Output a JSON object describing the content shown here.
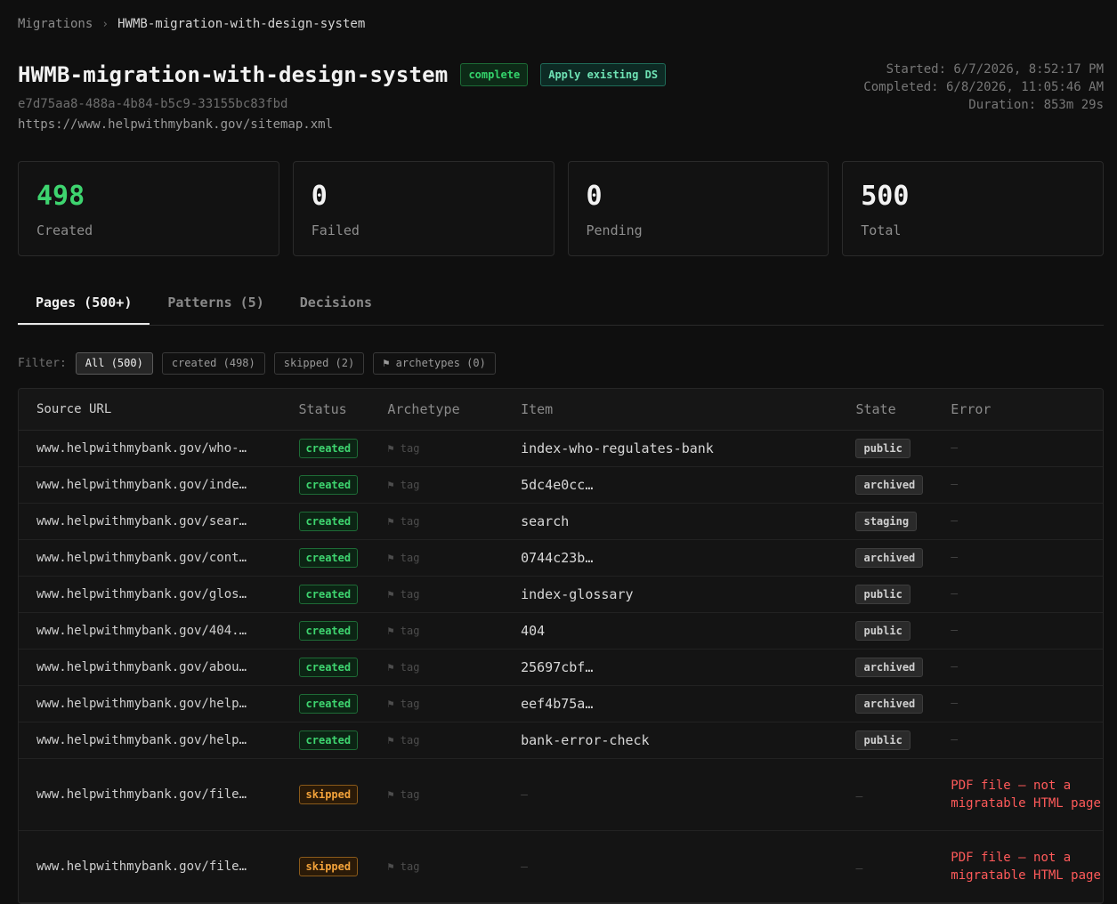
{
  "breadcrumb": {
    "root": "Migrations",
    "separator": "›",
    "current": "HWMB-migration-with-design-system"
  },
  "header": {
    "title": "HWMB-migration-with-design-system",
    "status_badge": "complete",
    "mode_badge": "Apply existing DS",
    "id": "e7d75aa8-488a-4b84-b5c9-33155bc83fbd",
    "url": "https://www.helpwithmybank.gov/sitemap.xml",
    "started": "Started: 6/7/2026, 8:52:17 PM",
    "completed": "Completed: 6/8/2026, 11:05:46 AM",
    "duration": "Duration: 853m 29s"
  },
  "stats": [
    {
      "value": "498",
      "label": "Created"
    },
    {
      "value": "0",
      "label": "Failed"
    },
    {
      "value": "0",
      "label": "Pending"
    },
    {
      "value": "500",
      "label": "Total"
    }
  ],
  "tabs": [
    {
      "label": "Pages (500+)"
    },
    {
      "label": "Patterns (5)"
    },
    {
      "label": "Decisions"
    }
  ],
  "filter": {
    "label": "Filter:",
    "chips": [
      "All (500)",
      "created (498)",
      "skipped (2)",
      "⚑ archetypes (0)"
    ]
  },
  "table": {
    "columns": [
      "Source URL",
      "Status",
      "Archetype",
      "Item",
      "State",
      "Error"
    ],
    "archetype_placeholder": "⚑ tag",
    "empty": "—",
    "rows": [
      {
        "url": "www.helpwithmybank.gov/who-…",
        "status": "created",
        "item": "index-who-regulates-bank",
        "state": "public",
        "error": "—"
      },
      {
        "url": "www.helpwithmybank.gov/inde…",
        "status": "created",
        "item": "5dc4e0cc…",
        "state": "archived",
        "error": "—"
      },
      {
        "url": "www.helpwithmybank.gov/sear…",
        "status": "created",
        "item": "search",
        "state": "staging",
        "error": "—"
      },
      {
        "url": "www.helpwithmybank.gov/cont…",
        "status": "created",
        "item": "0744c23b…",
        "state": "archived",
        "error": "—"
      },
      {
        "url": "www.helpwithmybank.gov/glos…",
        "status": "created",
        "item": "index-glossary",
        "state": "public",
        "error": "—"
      },
      {
        "url": "www.helpwithmybank.gov/404.…",
        "status": "created",
        "item": "404",
        "state": "public",
        "error": "—"
      },
      {
        "url": "www.helpwithmybank.gov/abou…",
        "status": "created",
        "item": "25697cbf…",
        "state": "archived",
        "error": "—"
      },
      {
        "url": "www.helpwithmybank.gov/help…",
        "status": "created",
        "item": "eef4b75a…",
        "state": "archived",
        "error": "—"
      },
      {
        "url": "www.helpwithmybank.gov/help…",
        "status": "created",
        "item": "bank-error-check",
        "state": "public",
        "error": "—"
      },
      {
        "url": "www.helpwithmybank.gov/file…",
        "status": "skipped",
        "item": "—",
        "state": "—",
        "error": "PDF file — not a migratable HTML page"
      },
      {
        "url": "www.helpwithmybank.gov/file…",
        "status": "skipped",
        "item": "—",
        "state": "—",
        "error": "PDF file — not a migratable HTML page"
      }
    ]
  },
  "colors": {
    "created": "#3ed46f",
    "skipped": "#f2a23a",
    "error": "#ff5a5a",
    "background": "#0f0f0f"
  }
}
